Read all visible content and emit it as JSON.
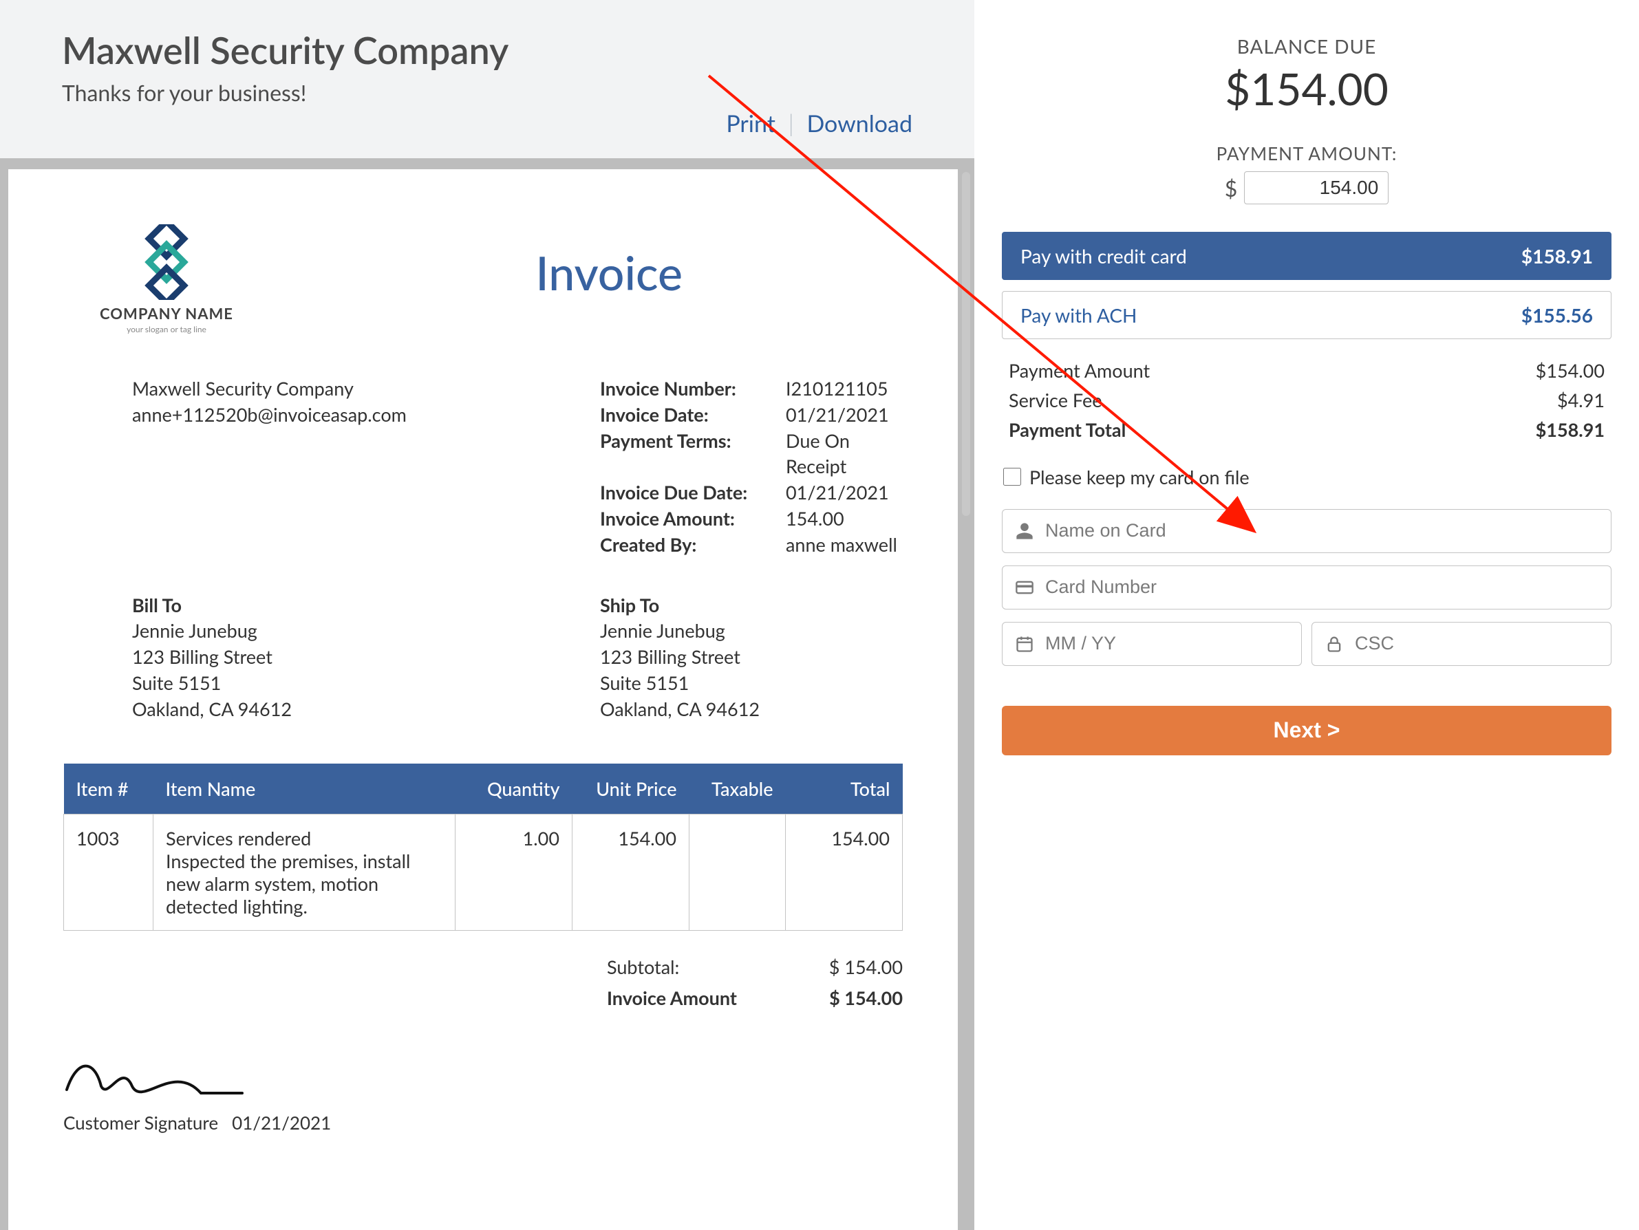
{
  "header": {
    "company_name": "Maxwell Security Company",
    "thanks": "Thanks for your business!",
    "print": "Print",
    "download": "Download"
  },
  "document": {
    "logo_text": "COMPANY NAME",
    "logo_sub": "your slogan or tag line",
    "title": "Invoice",
    "from": {
      "name": "Maxwell Security Company",
      "email": "anne+112520b@invoiceasap.com"
    },
    "meta": {
      "invoice_number_label": "Invoice Number:",
      "invoice_number": "I210121105",
      "invoice_date_label": "Invoice Date:",
      "invoice_date": "01/21/2021",
      "payment_terms_label": "Payment Terms:",
      "payment_terms": "Due On Receipt",
      "due_date_label": "Invoice Due Date:",
      "due_date": "01/21/2021",
      "invoice_amount_label": "Invoice Amount:",
      "invoice_amount": "154.00",
      "created_by_label": "Created By:",
      "created_by": "anne maxwell"
    },
    "bill_to": {
      "label": "Bill To",
      "name": "Jennie Junebug",
      "street": "123 Billing Street",
      "suite": "Suite 5151",
      "city": "Oakland, CA 94612"
    },
    "ship_to": {
      "label": "Ship To",
      "name": "Jennie Junebug",
      "street": "123 Billing Street",
      "suite": "Suite 5151",
      "city": "Oakland, CA 94612"
    },
    "columns": {
      "item_no": "Item #",
      "item_name": "Item Name",
      "quantity": "Quantity",
      "unit_price": "Unit Price",
      "taxable": "Taxable",
      "total": "Total"
    },
    "line_items": [
      {
        "item_no": "1003",
        "name": "Services rendered",
        "desc": "Inspected the premises, install new alarm system, motion detected lighting.",
        "quantity": "1.00",
        "unit_price": "154.00",
        "taxable": "",
        "total": "154.00"
      }
    ],
    "totals": {
      "subtotal_label": "Subtotal:",
      "subtotal": "$ 154.00",
      "invoice_amount_label": "Invoice Amount",
      "invoice_amount": "$ 154.00"
    },
    "signature": {
      "label": "Customer Signature",
      "date": "01/21/2021"
    }
  },
  "panel": {
    "balance_due_label": "BALANCE DUE",
    "balance_due": "$154.00",
    "payment_amount_label": "PAYMENT AMOUNT:",
    "payment_amount_value": "154.00",
    "pay_credit_label": "Pay with credit card",
    "pay_credit_amount": "$158.91",
    "pay_ach_label": "Pay with ACH",
    "pay_ach_amount": "$155.56",
    "fees": {
      "payment_amount_label": "Payment Amount",
      "payment_amount": "$154.00",
      "service_fee_label": "Service Fee",
      "service_fee": "$4.91",
      "payment_total_label": "Payment Total",
      "payment_total": "$158.91"
    },
    "keep_card_label": "Please keep my card on file",
    "name_placeholder": "Name on Card",
    "card_placeholder": "Card Number",
    "expiry_placeholder": "MM / YY",
    "csc_placeholder": "CSC",
    "next_button": "Next >"
  }
}
